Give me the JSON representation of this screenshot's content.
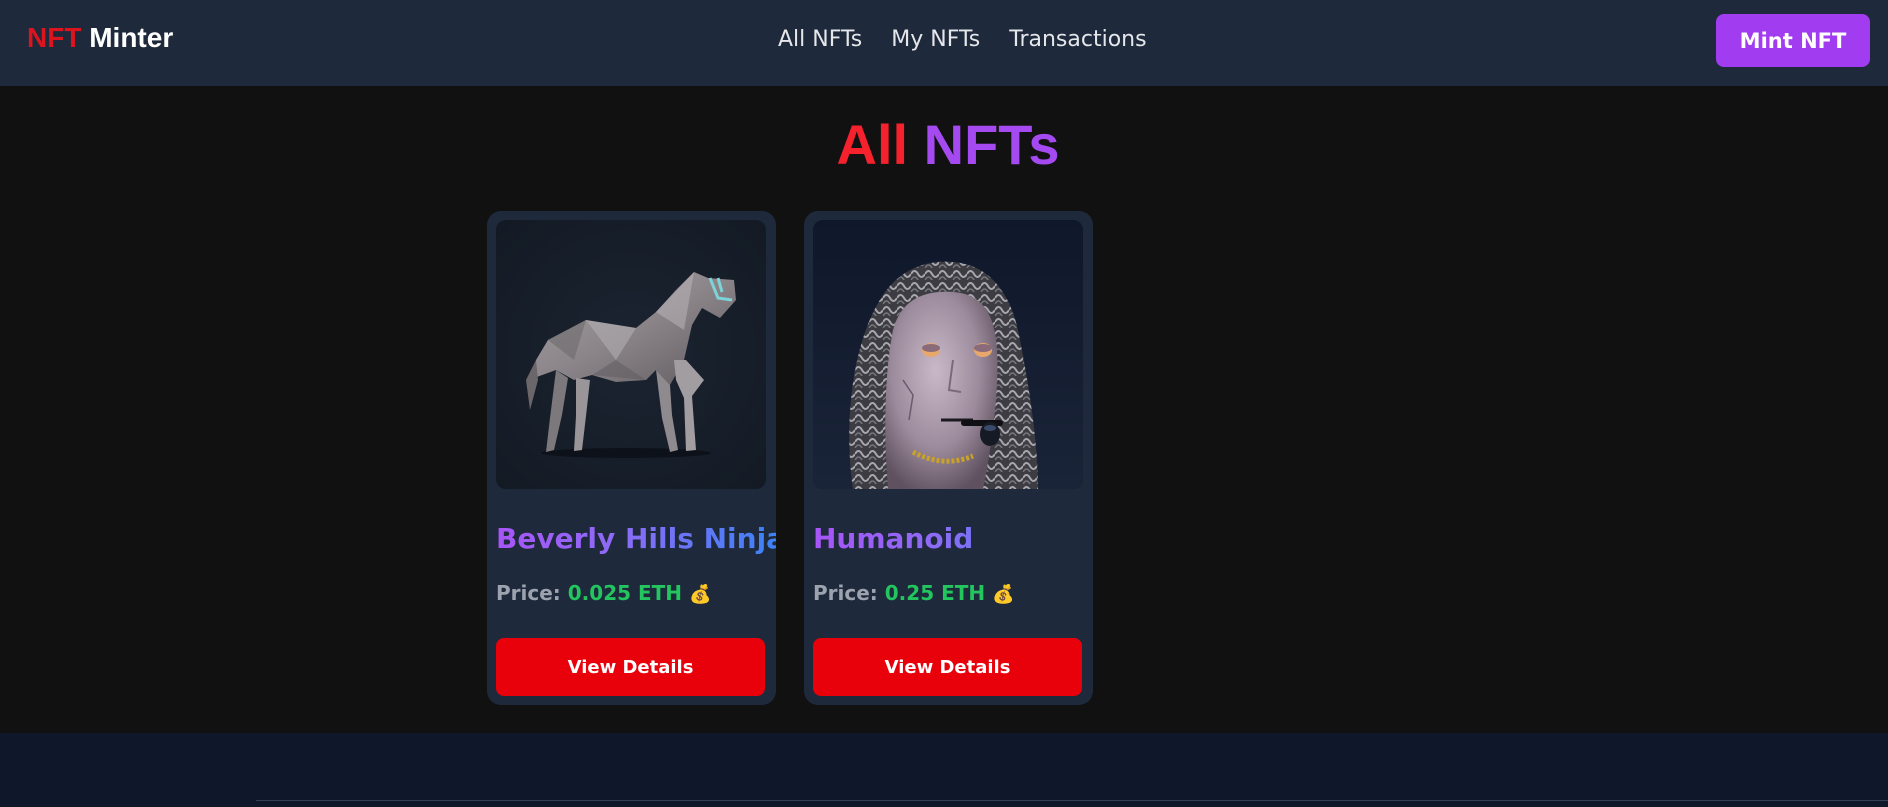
{
  "navbar": {
    "logo_part1": "NFT",
    "logo_part2": "Minter",
    "links": [
      "All NFTs",
      "My NFTs",
      "Transactions"
    ],
    "mint_button": "Mint NFT"
  },
  "page": {
    "title_part1": "All",
    "title_part2": "NFTs"
  },
  "cards": [
    {
      "name": "Beverly Hills Ninja",
      "price_label": "Price:",
      "price_value": "0.025 ETH",
      "price_icon": "💰",
      "button_label": "View Details",
      "image_icon": "low-poly-horse"
    },
    {
      "name": "Humanoid",
      "price_label": "Price:",
      "price_value": "0.25 ETH",
      "price_icon": "💰",
      "button_label": "View Details",
      "image_icon": "hooded-robot-head"
    }
  ],
  "colors": {
    "navbar_bg": "#1e293b",
    "page_bg": "#111111",
    "mint_button": "#a23cf0",
    "view_button": "#e8000b",
    "price_green": "#22c55e",
    "title_red": "#f5222d",
    "title_purple": "#a54af0"
  }
}
